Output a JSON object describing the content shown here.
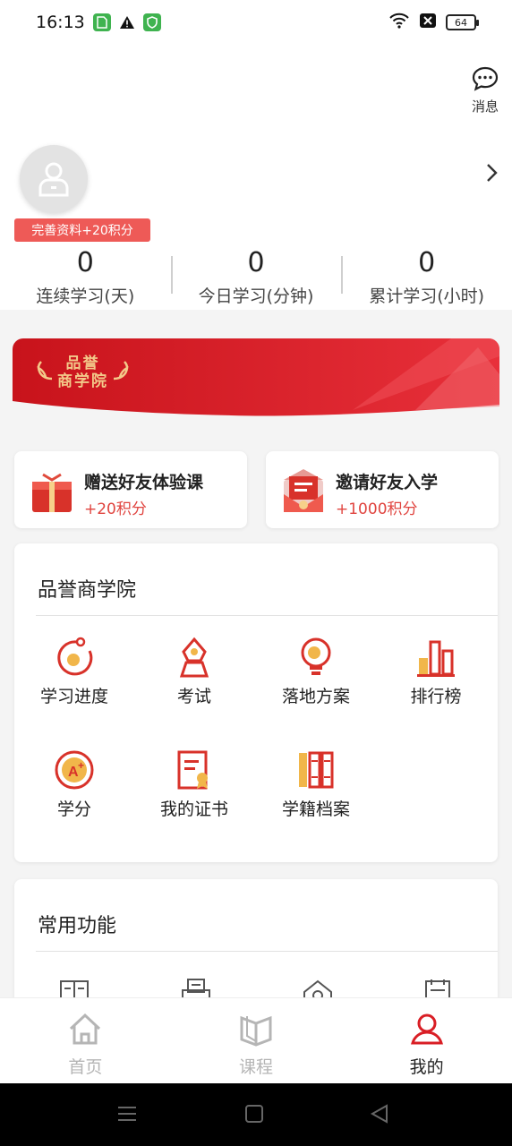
{
  "status_bar": {
    "time": "16:13",
    "battery": "64"
  },
  "header": {
    "message_label": "消息"
  },
  "profile": {
    "complete_badge": "完善资料+20积分"
  },
  "stats": [
    {
      "value": "0",
      "label": "连续学习(天)"
    },
    {
      "value": "0",
      "label": "今日学习(分钟)"
    },
    {
      "value": "0",
      "label": "累计学习(小时)"
    }
  ],
  "banner": {
    "logo_line1": "品誉",
    "logo_line2": "商学院"
  },
  "invites": [
    {
      "title": "赠送好友体验课",
      "points": "+20积分",
      "icon": "gift-icon"
    },
    {
      "title": "邀请好友入学",
      "points": "+1000积分",
      "icon": "envelope-icon"
    }
  ],
  "academy": {
    "title": "品誉商学院",
    "items": [
      {
        "label": "学习进度",
        "icon": "progress-icon"
      },
      {
        "label": "考试",
        "icon": "exam-pen-icon"
      },
      {
        "label": "落地方案",
        "icon": "lightbulb-icon"
      },
      {
        "label": "排行榜",
        "icon": "ranking-bars-icon"
      },
      {
        "label": "学分",
        "icon": "credit-a-plus-icon"
      },
      {
        "label": "我的证书",
        "icon": "certificate-icon"
      },
      {
        "label": "学籍档案",
        "icon": "archive-books-icon"
      }
    ]
  },
  "common": {
    "title": "常用功能"
  },
  "tabbar": [
    {
      "label": "首页",
      "icon": "home-icon",
      "active": false
    },
    {
      "label": "课程",
      "icon": "book-icon",
      "active": false
    },
    {
      "label": "我的",
      "icon": "user-icon",
      "active": true
    }
  ],
  "colors": {
    "accent": "#d91e25",
    "tab_inactive": "#b5b5b5",
    "points": "#e0443f"
  }
}
